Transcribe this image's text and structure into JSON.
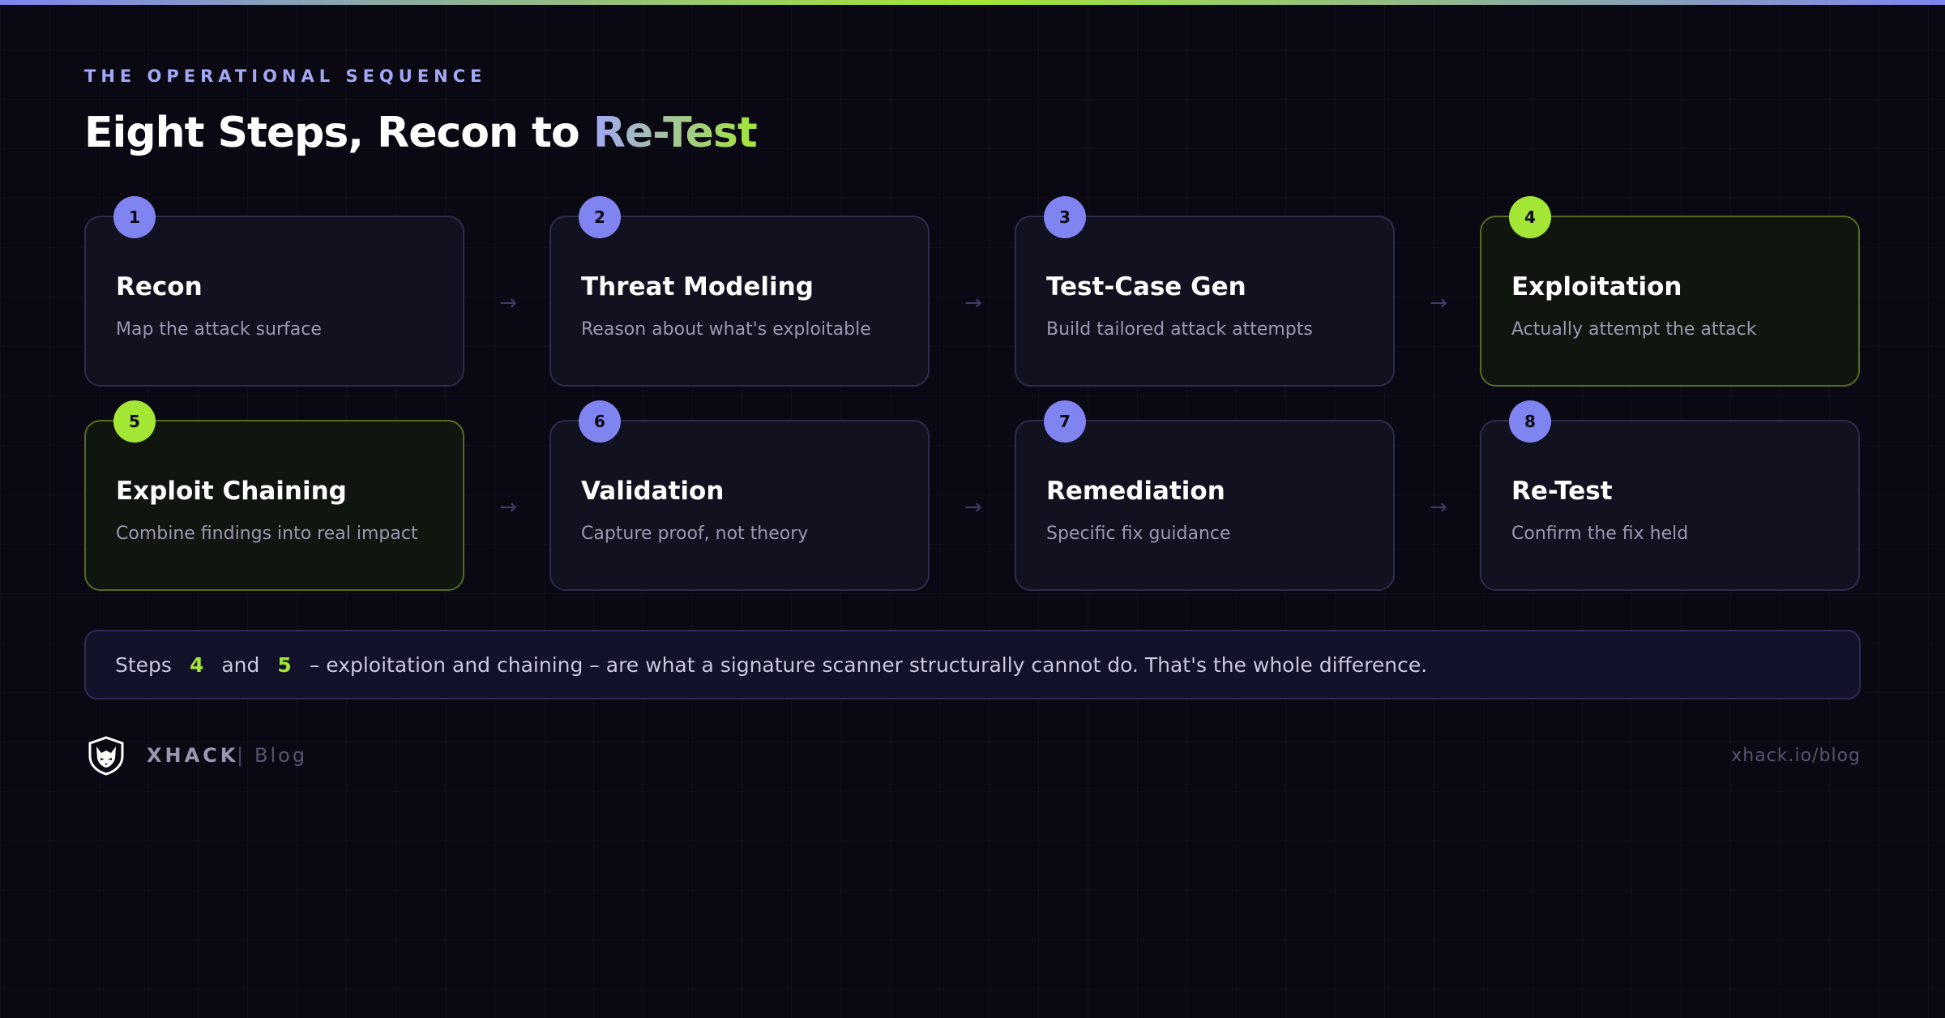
{
  "eyebrow": "THE OPERATIONAL SEQUENCE",
  "title": {
    "main": "Eight Steps, Recon to ",
    "accent": "Re-Test"
  },
  "steps": [
    {
      "num": "1",
      "title": "Recon",
      "desc": "Map the attack surface",
      "highlight": false
    },
    {
      "num": "2",
      "title": "Threat Modeling",
      "desc": "Reason about what's exploitable",
      "highlight": false
    },
    {
      "num": "3",
      "title": "Test-Case Gen",
      "desc": "Build tailored attack attempts",
      "highlight": false
    },
    {
      "num": "4",
      "title": "Exploitation",
      "desc": "Actually attempt the attack",
      "highlight": true
    },
    {
      "num": "5",
      "title": "Exploit Chaining",
      "desc": "Combine findings into real impact",
      "highlight": true
    },
    {
      "num": "6",
      "title": "Validation",
      "desc": "Capture proof, not theory",
      "highlight": false
    },
    {
      "num": "7",
      "title": "Remediation",
      "desc": "Specific fix guidance",
      "highlight": false
    },
    {
      "num": "8",
      "title": "Re-Test",
      "desc": "Confirm the fix held",
      "highlight": false
    }
  ],
  "arrow_glyph": "→",
  "note": {
    "prefix": "Steps",
    "num_a": "4",
    "and": "and",
    "num_b": "5",
    "suffix": "– exploitation and chaining – are what a signature scanner structurally cannot do. That's the whole difference."
  },
  "footer": {
    "brand": "XHACK",
    "separator": "|",
    "sub": "Blog",
    "url": "xhack.io/blog",
    "logo_icon": "wolf-shield-icon"
  },
  "colors": {
    "background": "#0a0913",
    "accent_purple": "#7f84f0",
    "accent_green": "#a3e635"
  }
}
